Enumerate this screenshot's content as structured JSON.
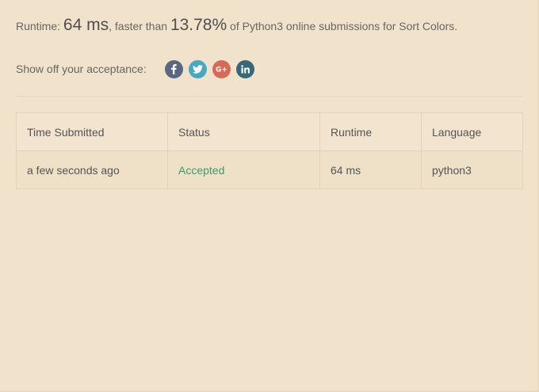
{
  "summary": {
    "runtime_label": "Runtime: ",
    "runtime_value": "64 ms",
    "faster_than": ", faster than ",
    "percent": "13.78%",
    "suffix": " of Python3 online submissions for Sort Colors."
  },
  "share": {
    "label": "Show off your acceptance:",
    "icons": [
      {
        "name": "facebook-icon",
        "glyph": "f",
        "color": "#5b6780"
      },
      {
        "name": "twitter-icon",
        "glyph": "t",
        "color": "#4aa7c1"
      },
      {
        "name": "google-plus-icon",
        "glyph": "G+",
        "color": "#d66a59"
      },
      {
        "name": "linkedin-icon",
        "glyph": "in",
        "color": "#38677a"
      }
    ]
  },
  "table": {
    "headers": [
      "Time Submitted",
      "Status",
      "Runtime",
      "Language"
    ],
    "rows": [
      {
        "time": "a few seconds ago",
        "status": "Accepted",
        "runtime": "64 ms",
        "language": "python3"
      }
    ]
  },
  "colors": {
    "background": "#f0e2cb",
    "accepted": "#3a9b67"
  }
}
